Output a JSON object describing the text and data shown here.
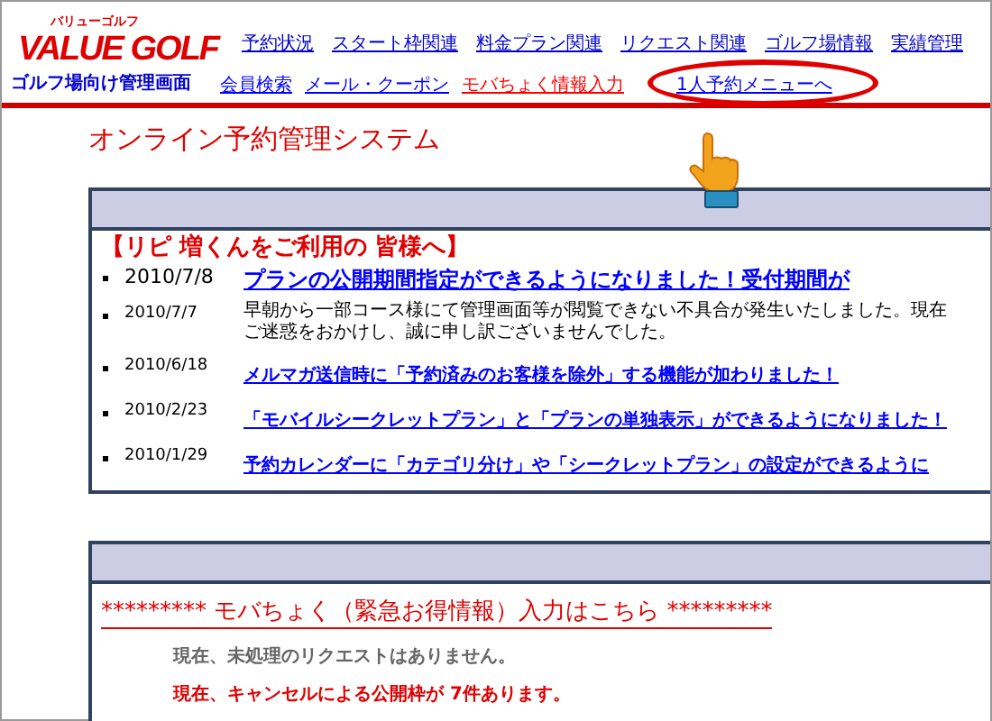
{
  "header": {
    "logo": {
      "reading": "バリューゴルフ",
      "text": "VALUE GOLF"
    },
    "subtitle": "ゴルフ場向け管理画面"
  },
  "nav": {
    "primary": [
      {
        "label": "予約状況"
      },
      {
        "label": "スタート枠関連"
      },
      {
        "label": "料金プラン関連"
      },
      {
        "label": "リクエスト関連"
      },
      {
        "label": "ゴルフ場情報"
      },
      {
        "label": "実績管理"
      }
    ],
    "secondary": [
      {
        "label": "会員検索",
        "color": "#0000ff",
        "circled": false
      },
      {
        "label": "メール・クーポン",
        "color": "#0000ff",
        "circled": false
      },
      {
        "label": "モバちょく情報入力",
        "color": "#ff0000",
        "circled": false
      },
      {
        "label": "1人予約メニューへ",
        "color": "#0000ff",
        "circled": true
      }
    ]
  },
  "page_title": "オンライン予約管理システム",
  "news_panel": {
    "title": "【リピ 増くんをご利用の 皆様へ】",
    "items": [
      {
        "date": "2010/7/8",
        "kind": "headline",
        "lines": [
          "プランの公開期間指定ができるようになりました！受付期間が"
        ]
      },
      {
        "date": "2010/7/7",
        "kind": "note",
        "lines": [
          "早朝から一部コース様にて管理画面等が閲覧できない不具合が発生いたしました。現在",
          "ご迷惑をおかけし、誠に申し訳ございませんでした。"
        ]
      },
      {
        "date": "2010/6/18",
        "kind": "link",
        "lines": [
          "メルマガ送信時に「予約済みのお客様を除外」する機能が加わりました！"
        ]
      },
      {
        "date": "2010/2/23",
        "kind": "link",
        "lines": [
          "「モバイルシークレットプラン」と「プランの単独表示」ができるようになりました！"
        ]
      },
      {
        "date": "2010/1/29",
        "kind": "link",
        "lines": [
          "予約カレンダーに「カテゴリ分け」や「シークレットプラン」の設定ができるように"
        ]
      }
    ]
  },
  "mobile_panel": {
    "title": "********* モバちょく（緊急お得情報）入力はこちら *********",
    "messages": [
      {
        "kind": "info",
        "text": "現在、未処理のリクエストはありません。"
      },
      {
        "kind": "alert",
        "text": "現在、キャンセルによる公開枠が 7件あります。"
      }
    ]
  }
}
